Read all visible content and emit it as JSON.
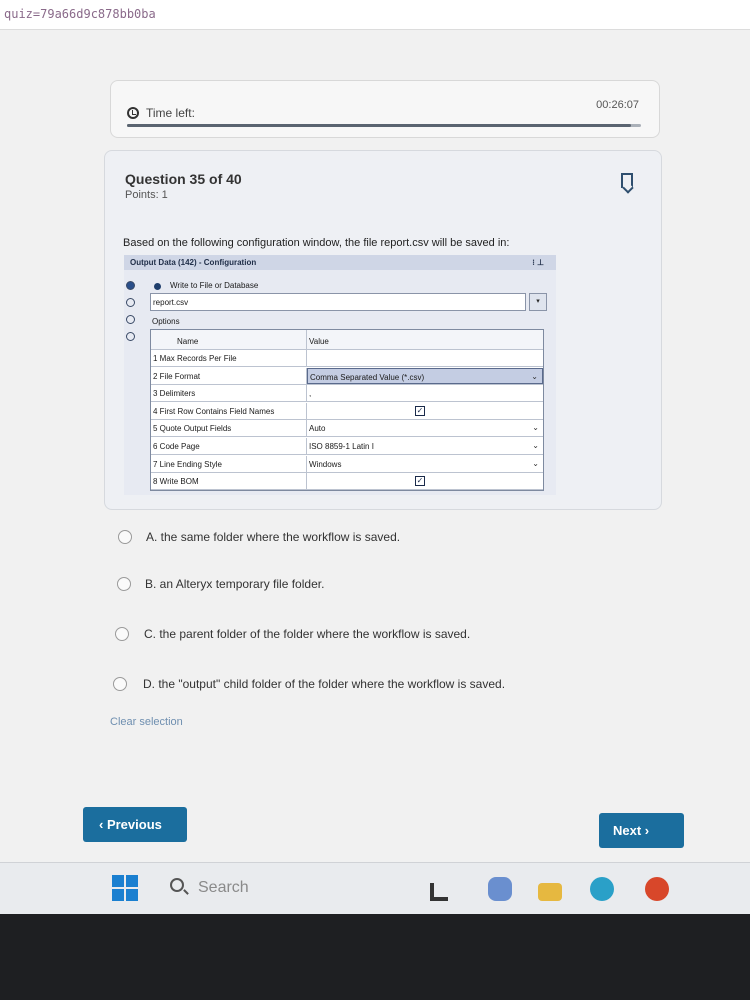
{
  "browser": {
    "url": "quiz=79a66d9c878bb0ba"
  },
  "timer": {
    "label": "Time left:",
    "value": "00:26:07",
    "progress": 0.98
  },
  "question": {
    "title": "Question 35 of 40",
    "points": "Points: 1",
    "text": "Based on the following configuration window, the file report.csv will be saved in:"
  },
  "config": {
    "title": "Output Data (142) - Configuration",
    "title_icons": "⁝ ⊥",
    "write_label": "Write to File or Database",
    "file_value": "report.csv",
    "options_label": "Options",
    "headers": {
      "name": "Name",
      "value": "Value"
    },
    "rows": [
      {
        "name": "1  Max Records Per File",
        "value": "",
        "type": "text"
      },
      {
        "name": "2  File Format",
        "value": "Comma Separated Value (*.csv)",
        "type": "select-selected"
      },
      {
        "name": "3  Delimiters",
        "value": ",",
        "type": "text"
      },
      {
        "name": "4  First Row Contains Field Names",
        "value": "",
        "type": "check"
      },
      {
        "name": "5  Quote Output Fields",
        "value": "Auto",
        "type": "select"
      },
      {
        "name": "6  Code Page",
        "value": "ISO 8859-1 Latin I",
        "type": "select"
      },
      {
        "name": "7  Line Ending Style",
        "value": "Windows",
        "type": "select"
      },
      {
        "name": "8  Write BOM",
        "value": "",
        "type": "check"
      }
    ]
  },
  "answers": [
    {
      "label": "A. the same folder where the workflow is saved."
    },
    {
      "label": "B. an Alteryx temporary file folder."
    },
    {
      "label": "C. the parent folder of the folder where the workflow is saved."
    },
    {
      "label": "D. the \"output\" child folder of the folder where the workflow is saved."
    }
  ],
  "clear_selection": "Clear selection",
  "nav": {
    "previous": "Previous",
    "next": "Next"
  },
  "taskbar": {
    "search": "Search"
  },
  "colors": {
    "accent": "#1b6e9e",
    "bookmark": "#2f4f6f"
  }
}
